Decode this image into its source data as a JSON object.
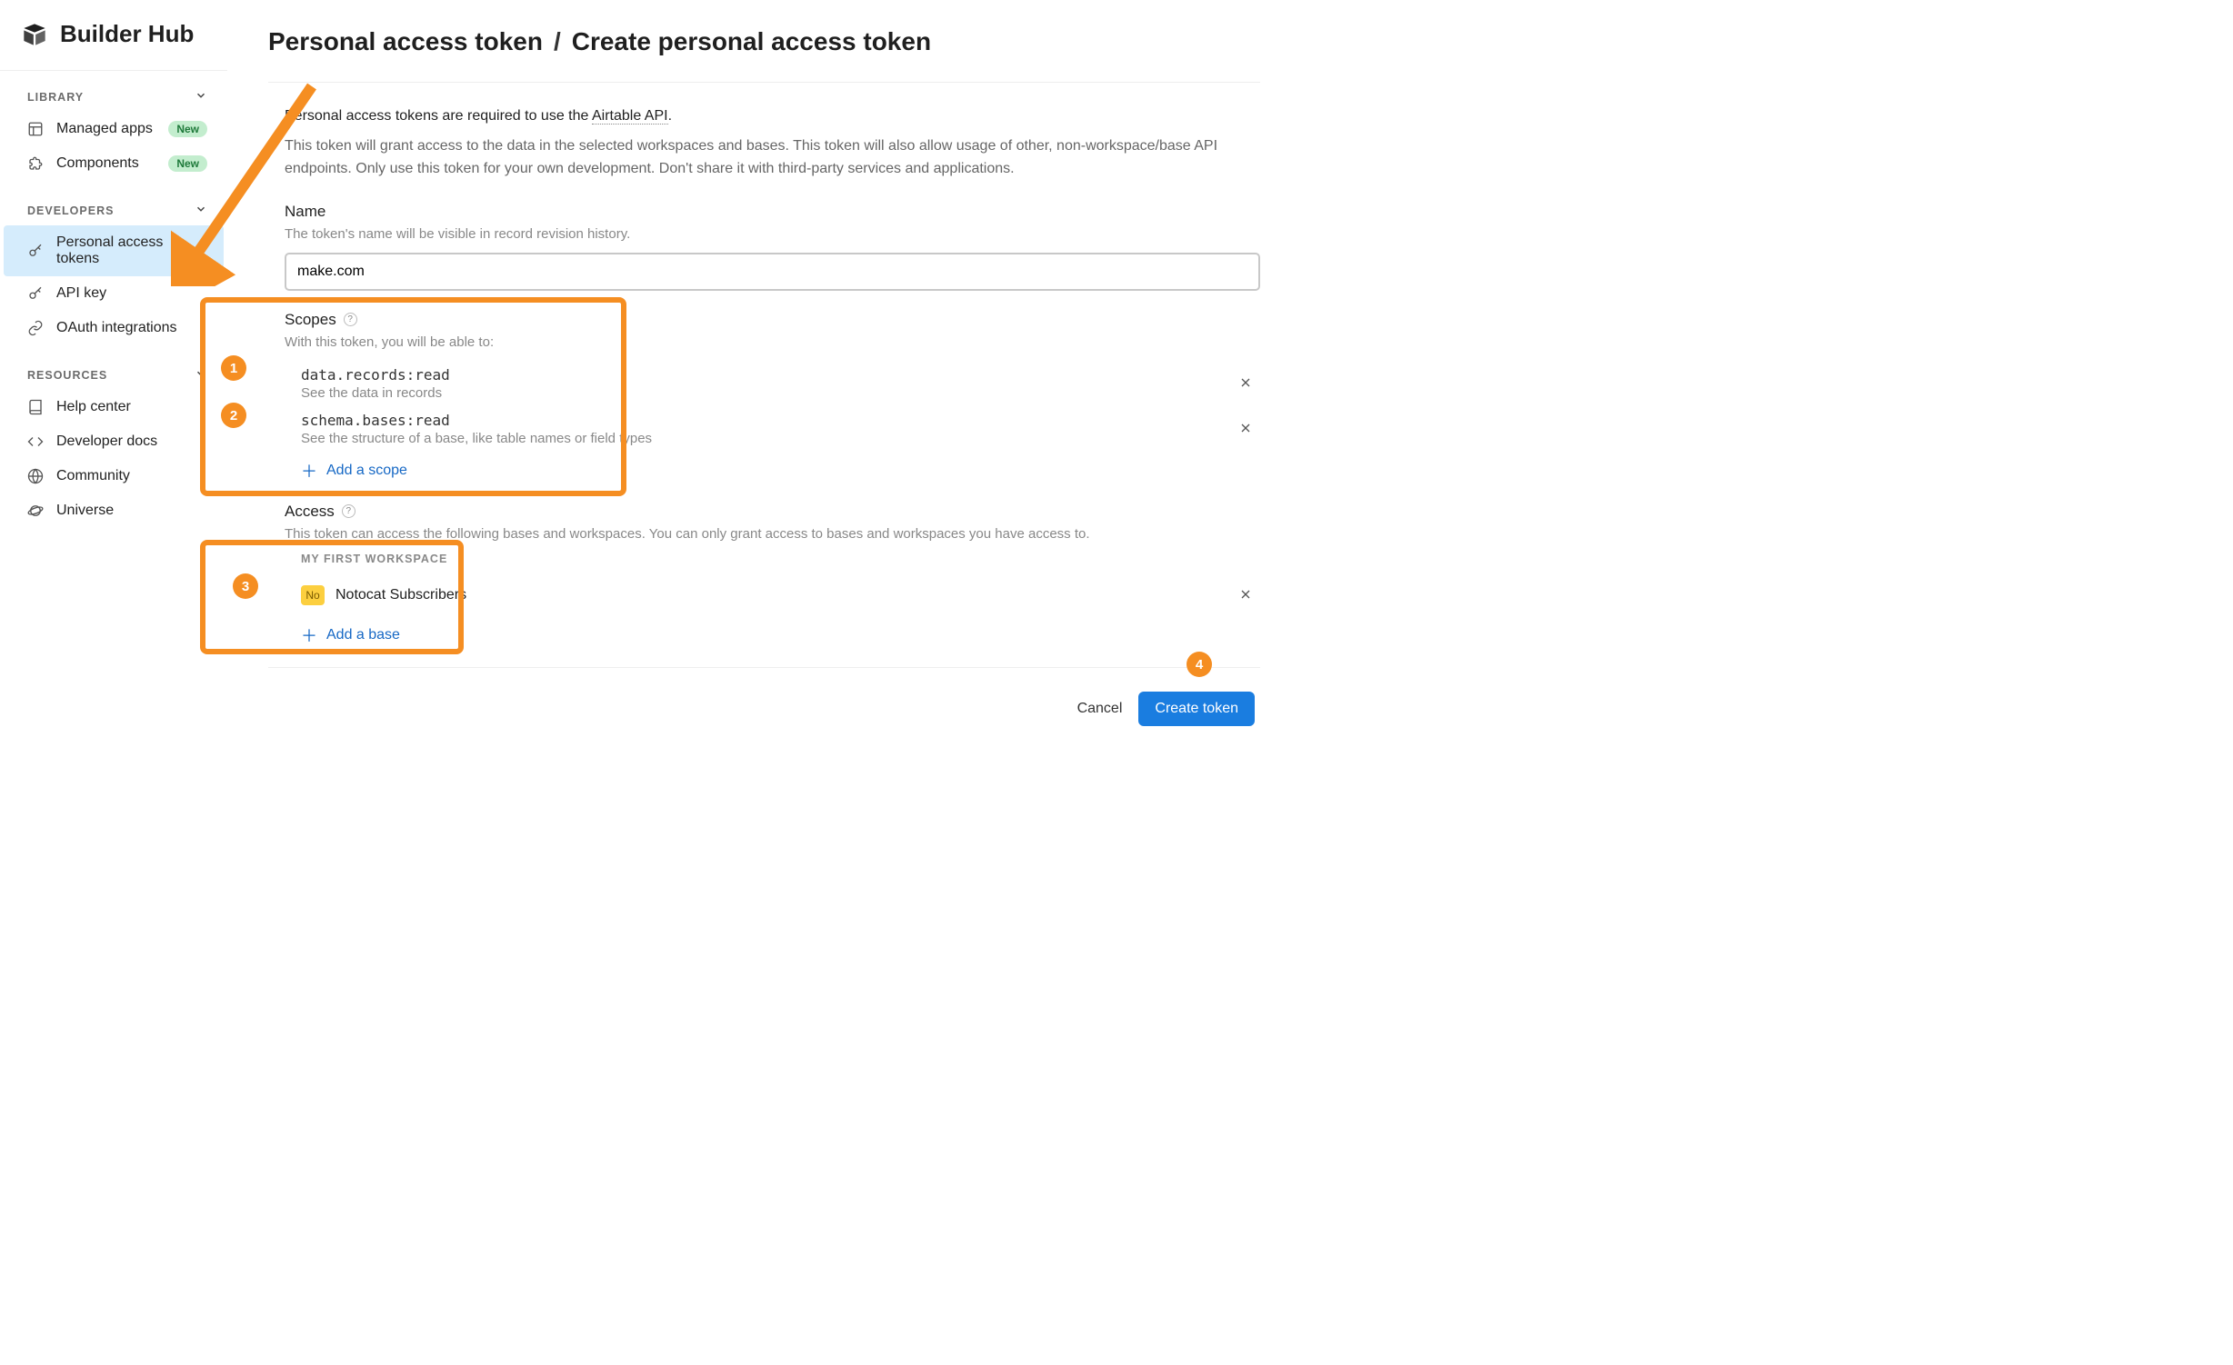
{
  "brand": "Builder Hub",
  "sidebar": {
    "sections": {
      "library": {
        "label": "LIBRARY"
      },
      "developers": {
        "label": "DEVELOPERS"
      },
      "resources": {
        "label": "RESOURCES"
      }
    },
    "items": {
      "managed_apps": {
        "label": "Managed apps",
        "badge": "New"
      },
      "components": {
        "label": "Components",
        "badge": "New"
      },
      "pat": {
        "label": "Personal access tokens"
      },
      "api_key": {
        "label": "API key"
      },
      "oauth": {
        "label": "OAuth integrations"
      },
      "help": {
        "label": "Help center"
      },
      "docs": {
        "label": "Developer docs"
      },
      "community": {
        "label": "Community"
      },
      "universe": {
        "label": "Universe"
      }
    }
  },
  "breadcrumb": {
    "parent": "Personal access token",
    "current": "Create personal access token"
  },
  "intro": {
    "line1_prefix": "Personal access tokens are required to use the ",
    "line1_link": "Airtable API",
    "line1_suffix": ".",
    "line2": "This token will grant access to the data in the selected workspaces and bases. This token will also allow usage of other, non-workspace/base API endpoints. Only use this token for your own development. Don't share it with third-party services and applications."
  },
  "name_section": {
    "label": "Name",
    "hint": "The token's name will be visible in record revision history.",
    "value": "make.com"
  },
  "scopes_section": {
    "label": "Scopes",
    "hint": "With this token, you will be able to:",
    "scopes": [
      {
        "code": "data.records:read",
        "desc": "See the data in records"
      },
      {
        "code": "schema.bases:read",
        "desc": "See the structure of a base, like table names or field types"
      }
    ],
    "add_label": "Add a scope"
  },
  "access_section": {
    "label": "Access",
    "hint": "This token can access the following bases and workspaces. You can only grant access to bases and workspaces you have access to.",
    "workspace_label": "MY FIRST WORKSPACE",
    "bases": [
      {
        "icon": "No",
        "name": "Notocat Subscribers"
      }
    ],
    "add_label": "Add a base"
  },
  "actions": {
    "cancel": "Cancel",
    "create": "Create token"
  },
  "annotations": {
    "steps": [
      "1",
      "2",
      "3",
      "4"
    ]
  }
}
